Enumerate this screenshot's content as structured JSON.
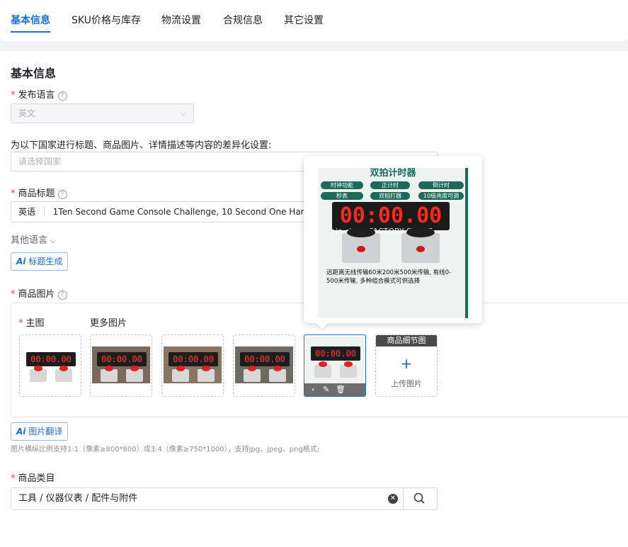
{
  "tabs": [
    "基本信息",
    "SKU价格与库存",
    "物流设置",
    "合规信息",
    "其它设置"
  ],
  "section_title": "基本信息",
  "publish_language": {
    "label": "发布语言",
    "value": "英文"
  },
  "country_setting": {
    "label": "为以下国家进行标题、商品图片、详情描述等内容的差异化设置:",
    "placeholder": "请选择国家"
  },
  "product_title": {
    "label": "商品标题",
    "lang": "英语",
    "value": "1Ten Second Game Console Challenge, 10 Second One Handed F"
  },
  "other_languages": "其他语言",
  "title_generate_btn": "标题生成",
  "product_images": {
    "label": "商品图片",
    "main_label": "主图",
    "more_label": "更多图片",
    "detail_label": "商品细节图",
    "upload_label": "上传图片",
    "thumb_display": "00:00.00"
  },
  "preview": {
    "title": "双拍计时器",
    "pills": [
      "时钟功能",
      "正计时",
      "倒计时",
      "秒表",
      "双拍打器",
      "10级亮度可调"
    ],
    "display": "00:00.00",
    "watermark": "ain.cb153FACTORY STORE",
    "caption": "远距离无线传输60米200米500米传输, 有线0-500米传输, 多种组合模式可供选择"
  },
  "image_translate_btn": "图片翻译",
  "image_hint": "图片横纵比例支持1:1（像素≥800*800）或3:4（像素≥750*1000），支持jpg、jpeg、png格式;",
  "category": {
    "label": "商品类目",
    "value": "工具 / 仪器仪表 / 配件与附件"
  },
  "colors": {
    "accent": "#1a6fdc",
    "required": "#e34d59"
  }
}
